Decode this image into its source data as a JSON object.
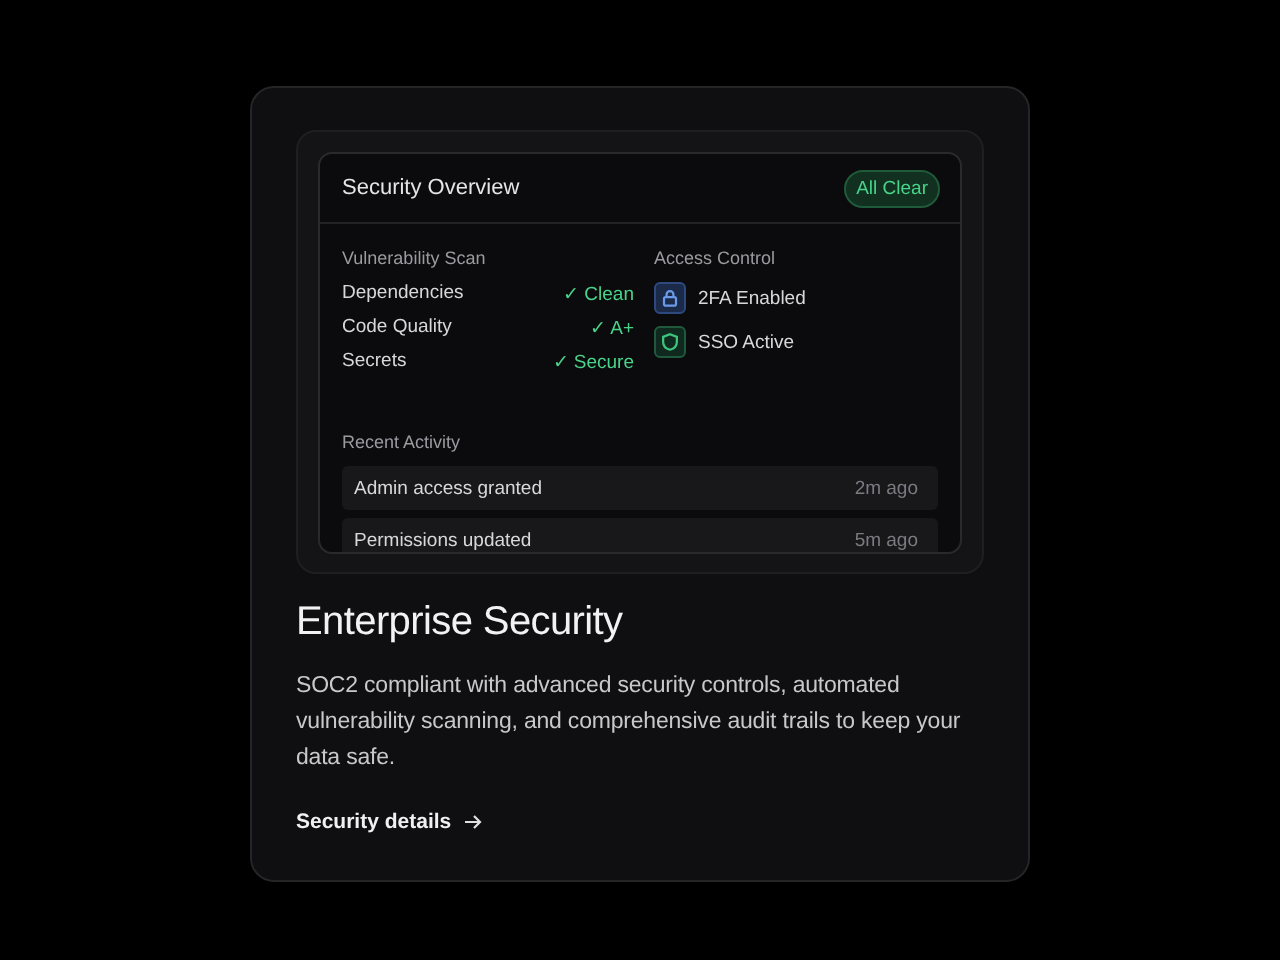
{
  "overview": {
    "title": "Security Overview",
    "badge": "All Clear",
    "scan": {
      "heading": "Vulnerability Scan",
      "rows": [
        {
          "label": "Dependencies",
          "status": "✓ Clean"
        },
        {
          "label": "Code Quality",
          "status": "✓ A+"
        },
        {
          "label": "Secrets",
          "status": "✓ Secure"
        }
      ]
    },
    "access": {
      "heading": "Access Control",
      "items": [
        {
          "kind": "lock",
          "label": "2FA Enabled"
        },
        {
          "kind": "shield",
          "label": "SSO Active"
        }
      ]
    },
    "activity": {
      "heading": "Recent Activity",
      "rows": [
        {
          "event": "Admin access granted",
          "time": "2m ago"
        },
        {
          "event": "Permissions updated",
          "time": "5m ago"
        }
      ]
    }
  },
  "title": "Enterprise Security",
  "description": "SOC2 compliant with advanced security controls, automated vulnerability scanning, and comprehensive audit trails to keep your data safe.",
  "link": "Security details"
}
